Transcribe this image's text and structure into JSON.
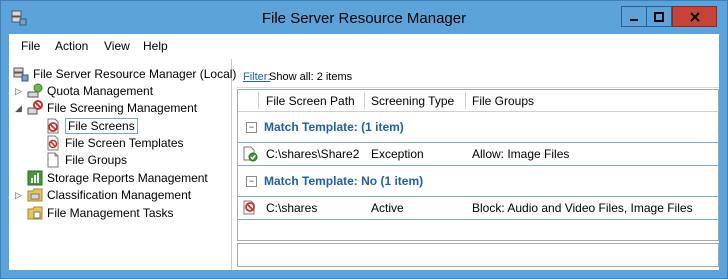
{
  "window": {
    "title": "File Server Resource Manager"
  },
  "menu": {
    "items": [
      "File",
      "Action",
      "View",
      "Help"
    ]
  },
  "tree": {
    "root": "File Server Resource Manager (Local)",
    "items": [
      "Quota Management",
      "File Screening Management",
      "File Screens",
      "File Screen Templates",
      "File Groups",
      "Storage Reports Management",
      "Classification Management",
      "File Management Tasks"
    ]
  },
  "filter": {
    "link": "Filter:",
    "text": "Show all: 2 items"
  },
  "columns": [
    "File Screen Path",
    "Screening Type",
    "File Groups"
  ],
  "groups": [
    {
      "title": "Match Template:  (1 item)",
      "rows": [
        {
          "path": "C:\\shares\\Share2",
          "type": "Exception",
          "groups": "Allow: Image Files"
        }
      ]
    },
    {
      "title": "Match Template: No (1 item)",
      "rows": [
        {
          "path": "C:\\shares",
          "type": "Active",
          "groups": "Block: Audio and Video Files, Image Files"
        }
      ]
    }
  ],
  "icons": {
    "app": "server-icon",
    "minimize": "minimize-icon",
    "maximize": "maximize-icon",
    "close": "close-icon"
  },
  "colors": {
    "titlebar": "#5ba3d9",
    "close": "#c7433a",
    "group_title": "#1e5fa8",
    "link": "#1f5fb5"
  }
}
